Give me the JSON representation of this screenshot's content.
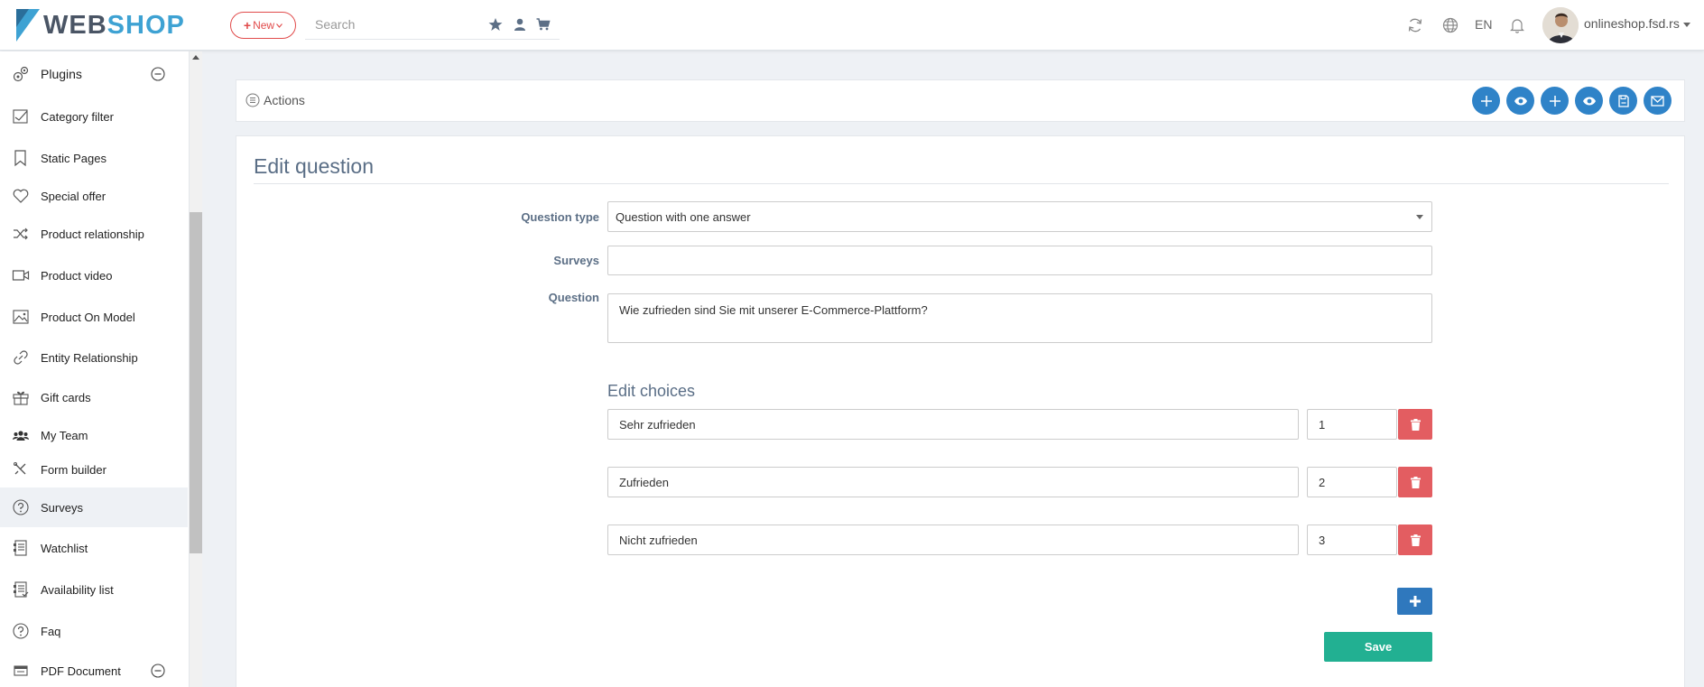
{
  "header": {
    "brand_web": "WEB",
    "brand_shop": "SHOP",
    "new_label": "New",
    "search_placeholder": "Search",
    "lang": "EN",
    "user": "onlineshop.fsd.rs"
  },
  "sidebar": {
    "items": [
      {
        "label": "Plugins",
        "icon": "plugins-icon"
      },
      {
        "label": "Category filter",
        "icon": "filter-icon"
      },
      {
        "label": "Static Pages",
        "icon": "bookmark-icon"
      },
      {
        "label": "Special offer",
        "icon": "heart-icon"
      },
      {
        "label": "Product relationship",
        "icon": "shuffle-icon"
      },
      {
        "label": "Product video",
        "icon": "video-icon"
      },
      {
        "label": "Product On Model",
        "icon": "image-icon"
      },
      {
        "label": "Entity Relationship",
        "icon": "link-icon"
      },
      {
        "label": "Gift cards",
        "icon": "gift-icon"
      },
      {
        "label": "My Team",
        "icon": "team-icon"
      },
      {
        "label": "Form builder",
        "icon": "tools-icon"
      },
      {
        "label": "Surveys",
        "icon": "question-circle-icon"
      },
      {
        "label": "Watchlist",
        "icon": "list-icon"
      },
      {
        "label": "Availability list",
        "icon": "list-check-icon"
      },
      {
        "label": "Faq",
        "icon": "question-circle-icon"
      },
      {
        "label": "PDF Document",
        "icon": "pdf-icon"
      }
    ]
  },
  "actions": {
    "label": "Actions"
  },
  "form": {
    "title": "Edit question",
    "question_type_label": "Question type",
    "question_type_value": "Question with one answer",
    "surveys_label": "Surveys",
    "surveys_value": "",
    "question_label": "Question",
    "question_value": "Wie zufrieden sind Sie mit unserer E-Commerce-Plattform?",
    "choices_title": "Edit choices",
    "choices": [
      {
        "text": "Sehr zufrieden",
        "order": "1"
      },
      {
        "text": "Zufrieden",
        "order": "2"
      },
      {
        "text": "Nicht zufrieden",
        "order": "3"
      }
    ],
    "save_label": "Save"
  },
  "colors": {
    "accent_blue": "#2f83c8",
    "delete_red": "#e35d61",
    "save_green": "#22b092",
    "new_red": "#e14b4b"
  }
}
